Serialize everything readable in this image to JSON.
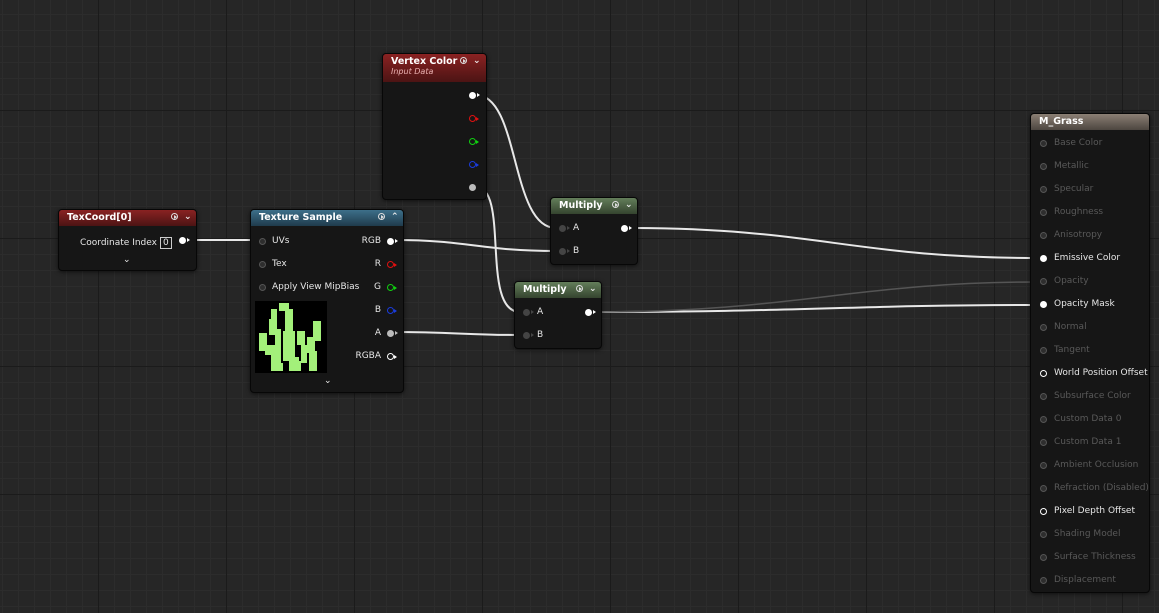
{
  "nodes": {
    "vertex_color": {
      "title": "Vertex Color",
      "subtitle": "Input Data"
    },
    "texcoord": {
      "title": "TexCoord[0]",
      "coordinate_index_label": "Coordinate Index",
      "coordinate_index_value": "0"
    },
    "texture_sample": {
      "title": "Texture Sample",
      "inputs": [
        "UVs",
        "Tex",
        "Apply View MipBias"
      ],
      "outputs": [
        "RGB",
        "R",
        "G",
        "B",
        "A",
        "RGBA"
      ]
    },
    "multiply_1": {
      "title": "Multiply",
      "inputs": [
        "A",
        "B"
      ]
    },
    "multiply_2": {
      "title": "Multiply",
      "inputs": [
        "A",
        "B"
      ]
    },
    "material_result": {
      "title": "M_Grass",
      "pins": [
        {
          "label": "Base Color",
          "active": false
        },
        {
          "label": "Metallic",
          "active": false
        },
        {
          "label": "Specular",
          "active": false
        },
        {
          "label": "Roughness",
          "active": false
        },
        {
          "label": "Anisotropy",
          "active": false
        },
        {
          "label": "Emissive Color",
          "active": true
        },
        {
          "label": "Opacity",
          "active": false
        },
        {
          "label": "Opacity Mask",
          "active": true
        },
        {
          "label": "Normal",
          "active": false
        },
        {
          "label": "Tangent",
          "active": false
        },
        {
          "label": "World Position Offset",
          "active": true
        },
        {
          "label": "Subsurface Color",
          "active": false
        },
        {
          "label": "Custom Data 0",
          "active": false
        },
        {
          "label": "Custom Data 1",
          "active": false
        },
        {
          "label": "Ambient Occlusion",
          "active": false
        },
        {
          "label": "Refraction (Disabled)",
          "active": false
        },
        {
          "label": "Pixel Depth Offset",
          "active": true
        },
        {
          "label": "Shading Model",
          "active": false
        },
        {
          "label": "Surface Thickness",
          "active": false
        },
        {
          "label": "Displacement",
          "active": false
        }
      ]
    }
  },
  "colors": {
    "canvas": "#262626",
    "header_red": "#8a2222",
    "header_blue": "#3d6f8a",
    "header_green": "#637e5a",
    "header_brown": "#8b7f74",
    "texture_green": "#a3f07a"
  }
}
